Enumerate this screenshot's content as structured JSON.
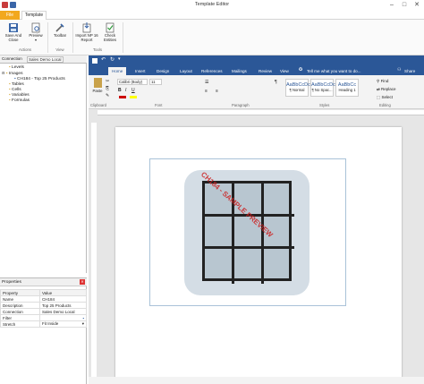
{
  "app": {
    "title": "Template Editor"
  },
  "ribbon": {
    "file_tab": "File",
    "template_tab": "Template",
    "buttons": {
      "save_close": "Save And Close",
      "preview": "Preview",
      "toolbar": "Toolbar",
      "import": "Import NP 16 Report",
      "check": "Check Entities"
    },
    "groups": {
      "actions": "Actions",
      "view": "View",
      "tools": "Tools"
    }
  },
  "left": {
    "tabs": {
      "connection": "Connection",
      "sales": "Sales Demo Local"
    },
    "tree": [
      {
        "label": "Levels"
      },
      {
        "label": "Images"
      },
      {
        "label": "CH184 - Top 25 Products"
      },
      {
        "label": "Tables"
      },
      {
        "label": "Cells"
      },
      {
        "label": "Variables"
      },
      {
        "label": "Formulas"
      }
    ]
  },
  "properties": {
    "title": "Properties",
    "head": {
      "property": "Property",
      "value": "Value"
    },
    "rows": [
      {
        "k": "Name",
        "v": "CH184"
      },
      {
        "k": "Description",
        "v": "Top 25 Products"
      },
      {
        "k": "Connection",
        "v": "Sales Demo Local"
      },
      {
        "k": "Filter",
        "v": ""
      },
      {
        "k": "Stretch",
        "v": "Fit Inside"
      }
    ]
  },
  "word": {
    "tabs": [
      "Home",
      "Insert",
      "Design",
      "Layout",
      "References",
      "Mailings",
      "Review",
      "View"
    ],
    "tellme": "Tell me what you want to do...",
    "share": "Share",
    "font_name": "Calibri (Body)",
    "font_size": "11",
    "paste": "Paste",
    "groups": {
      "clipboard": "Clipboard",
      "font": "Font",
      "paragraph": "Paragraph",
      "styles": "Styles",
      "editing": "Editing"
    },
    "styles": [
      {
        "sample": "AaBbCcDc",
        "name": "¶ Normal"
      },
      {
        "sample": "AaBbCcDc",
        "name": "¶ No Spac..."
      },
      {
        "sample": "AaBbCc",
        "name": "Heading 1"
      }
    ],
    "editing": {
      "find": "Find",
      "replace": "Replace",
      "select": "Select"
    },
    "watermark": "CH184 - SAMPLE PREVIEW"
  }
}
